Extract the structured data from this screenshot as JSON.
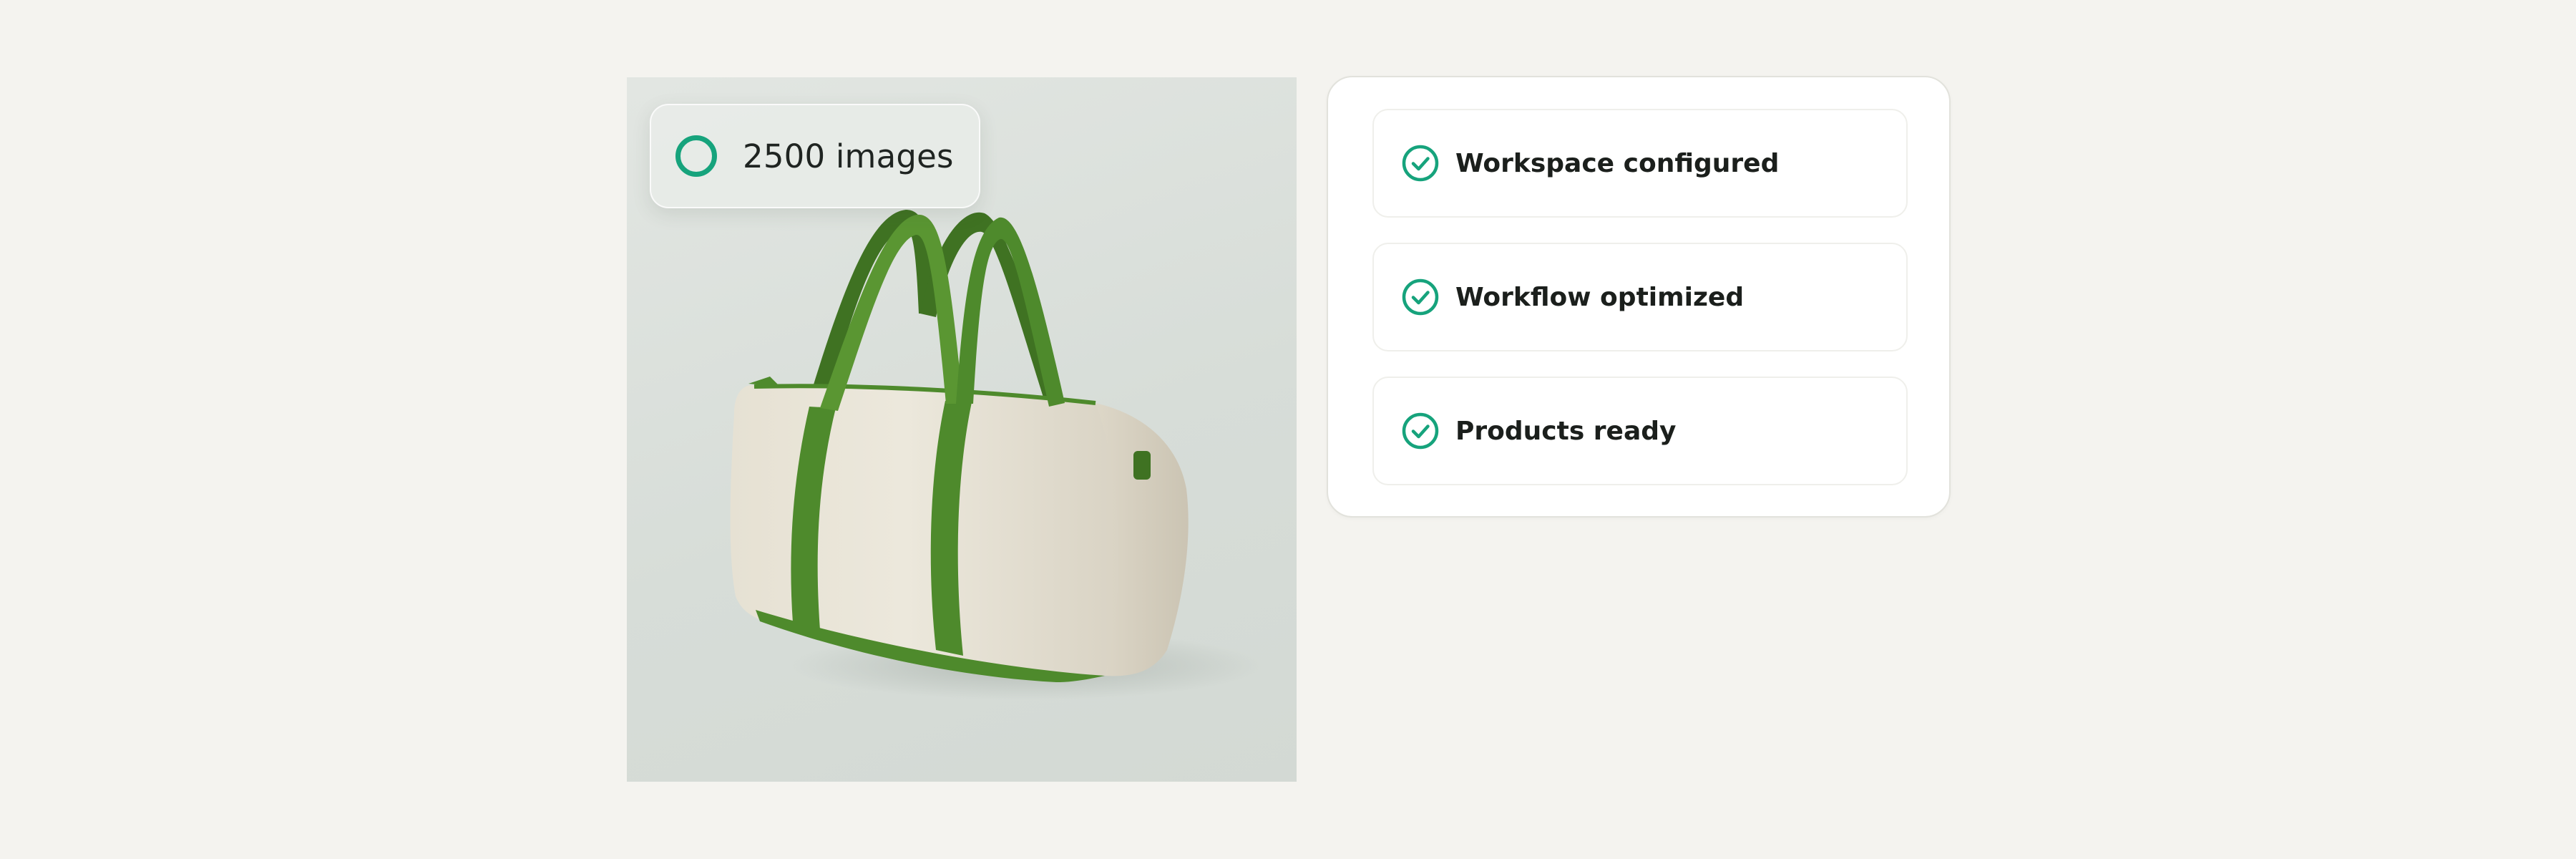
{
  "image_panel": {
    "count_label": "2500 images",
    "ring_icon": "progress-ring-icon",
    "image_icon": "duffel-bag-photo"
  },
  "status_card": {
    "items": [
      {
        "label": "Workspace configured",
        "icon": "check-circle-icon"
      },
      {
        "label": "Workflow optimized",
        "icon": "check-circle-icon"
      },
      {
        "label": "Products ready",
        "icon": "check-circle-icon"
      }
    ]
  },
  "colors": {
    "accent": "#16a37c",
    "page_background": "#f4f3ef",
    "strap_green": "#4e8a2c",
    "bag_canvas": "#e8e3d6"
  }
}
